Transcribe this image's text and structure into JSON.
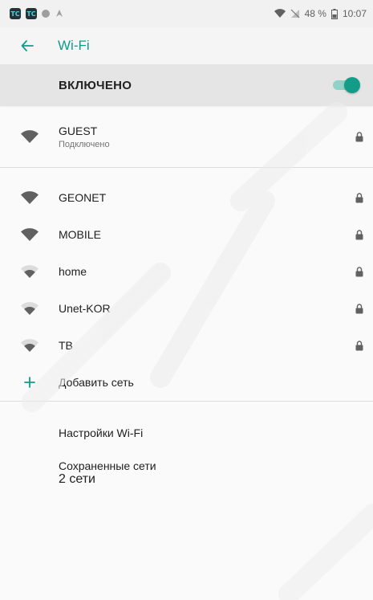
{
  "status_bar": {
    "app_icons": [
      "TC",
      "TC"
    ],
    "battery": "48 %",
    "time": "10:07",
    "icons": [
      "app-tc-icon",
      "app-tc-icon",
      "circle-icon",
      "navigation-icon",
      "wifi-signal-icon",
      "no-signal-icon",
      "battery-icon"
    ]
  },
  "app_bar": {
    "title": "Wi-Fi",
    "back_icon": "arrow-left-icon"
  },
  "master_switch": {
    "label": "ВКЛЮЧЕНО",
    "on": true,
    "accent": "#139d88",
    "track": "#8fd2c8"
  },
  "connected": {
    "ssid": "GUEST",
    "status": "Подключено",
    "signal": "full",
    "secured": true
  },
  "networks": [
    {
      "ssid": "GEONET",
      "signal": "full",
      "secured": true
    },
    {
      "ssid": "MOBILE",
      "signal": "full",
      "secured": true
    },
    {
      "ssid": "home",
      "signal": "weak",
      "secured": true
    },
    {
      "ssid": "Unet-KOR",
      "signal": "weak",
      "secured": true
    },
    {
      "ssid": "TB",
      "signal": "weak",
      "secured": true
    }
  ],
  "add_network": {
    "label": "Добавить сеть",
    "icon": "plus-icon"
  },
  "wifi_settings": {
    "label": "Настройки Wi-Fi"
  },
  "saved_networks": {
    "label": "Сохраненные сети",
    "sub": "2 сети"
  },
  "colors": {
    "accent": "#0f9d8a",
    "background": "#fafafa",
    "master_bg": "#e5e5e5"
  }
}
